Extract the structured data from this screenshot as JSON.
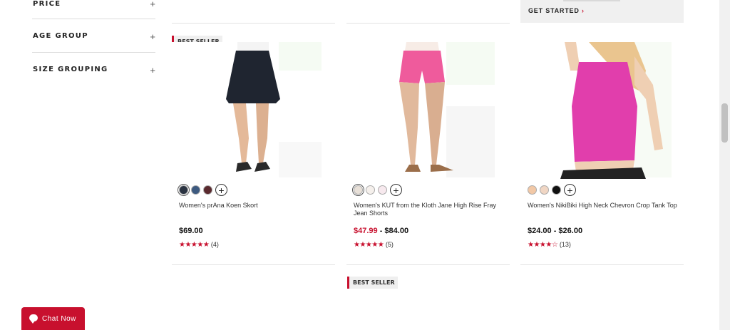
{
  "filters": [
    {
      "label": "PRICE"
    },
    {
      "label": "AGE GROUP"
    },
    {
      "label": "SIZE GROUPING"
    }
  ],
  "promo": {
    "cta": "GET STARTED",
    "arrow": "›"
  },
  "products": [
    {
      "badge": "BEST SELLER",
      "name": "Women's prAna Koen Skort",
      "price": "$69.00",
      "price_sale": "",
      "price_regular": "",
      "stars": "★★★★★",
      "reviews": "(4)",
      "swatches": [
        "#2b3442",
        "#3d5a80",
        "#5a2a2e"
      ]
    },
    {
      "badge": "",
      "name": "Women's KUT from the Kloth Jane High Rise Fray Jean Shorts",
      "price": "",
      "price_sale": "$47.99",
      "price_regular": " - $84.00",
      "stars": "★★★★★",
      "reviews": "(5)",
      "swatches": [
        "#e8e0d8",
        "#f5f0ec",
        "#f7e9ee"
      ]
    },
    {
      "badge": "",
      "name": "Women's NikiBiki High Neck Chevron Crop Tank Top",
      "price": "$24.00 - $26.00",
      "price_sale": "",
      "price_regular": "",
      "stars": "★★★★☆",
      "reviews": "(13)",
      "swatches": [
        "#f2c8a6",
        "#f0d6c4",
        "#111111"
      ]
    }
  ],
  "next_row": {
    "badge": "BEST SELLER"
  },
  "chat": {
    "label": "Chat Now"
  },
  "colors": {
    "accent": "#c8102e"
  }
}
